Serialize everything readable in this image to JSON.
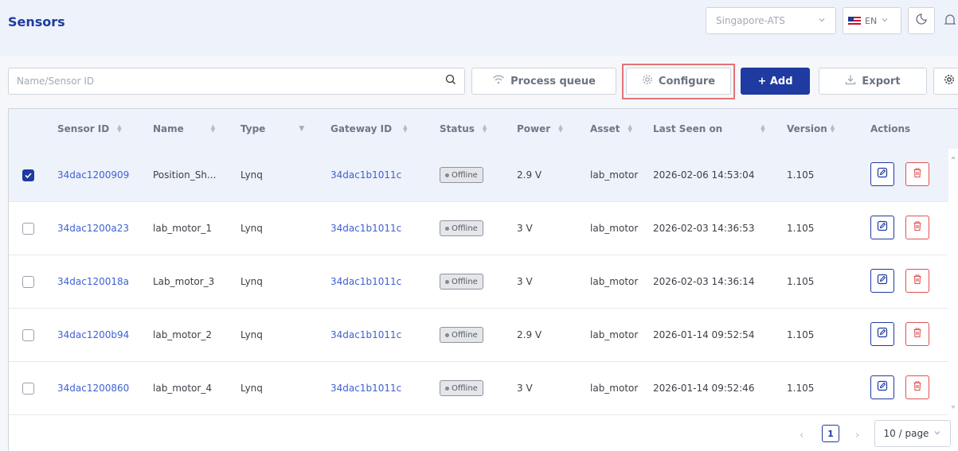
{
  "header": {
    "title": "Sensors",
    "site_selected": "Singapore-ATS",
    "language": "EN"
  },
  "toolbar": {
    "search_placeholder": "Name/Sensor ID",
    "process_queue_label": "Process queue",
    "configure_label": "Configure",
    "add_label": "+ Add",
    "export_label": "Export"
  },
  "table": {
    "columns": [
      "Sensor ID",
      "Name",
      "Type",
      "Gateway ID",
      "Status",
      "Power",
      "Asset",
      "Last Seen on",
      "Version",
      "Actions"
    ],
    "rows": [
      {
        "sensor_id": "34dac1200909",
        "name": "Position_Sh...",
        "type": "Lynq",
        "gateway_id": "34dac1b1011c",
        "status": "Offline",
        "power": "2.9 V",
        "asset": "lab_motor",
        "last_seen": "2026-02-06 14:53:04",
        "version": "1.105",
        "selected": true
      },
      {
        "sensor_id": "34dac1200a23",
        "name": "lab_motor_1",
        "type": "Lynq",
        "gateway_id": "34dac1b1011c",
        "status": "Offline",
        "power": "3 V",
        "asset": "lab_motor",
        "last_seen": "2026-02-03 14:36:53",
        "version": "1.105",
        "selected": false
      },
      {
        "sensor_id": "34dac120018a",
        "name": "Lab_motor_3",
        "type": "Lynq",
        "gateway_id": "34dac1b1011c",
        "status": "Offline",
        "power": "3 V",
        "asset": "lab_motor",
        "last_seen": "2026-02-03 14:36:14",
        "version": "1.105",
        "selected": false
      },
      {
        "sensor_id": "34dac1200b94",
        "name": "lab_motor_2",
        "type": "Lynq",
        "gateway_id": "34dac1b1011c",
        "status": "Offline",
        "power": "2.9 V",
        "asset": "lab_motor",
        "last_seen": "2026-01-14 09:52:54",
        "version": "1.105",
        "selected": false
      },
      {
        "sensor_id": "34dac1200860",
        "name": "lab_motor_4",
        "type": "Lynq",
        "gateway_id": "34dac1b1011c",
        "status": "Offline",
        "power": "3 V",
        "asset": "lab_motor",
        "last_seen": "2026-01-14 09:52:46",
        "version": "1.105",
        "selected": false
      }
    ]
  },
  "pagination": {
    "current_page": "1",
    "page_size": "10 / page"
  },
  "colors": {
    "primary": "#1f3aa0",
    "link": "#3f61d2",
    "danger": "#e05252",
    "highlight": "#e57373"
  }
}
